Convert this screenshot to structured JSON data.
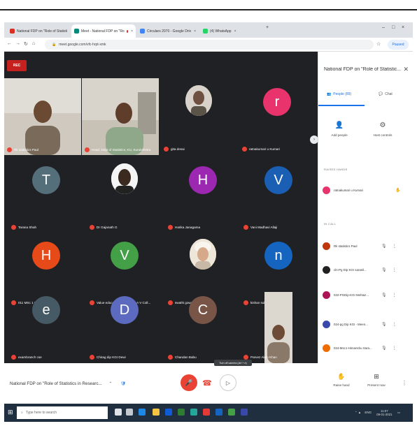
{
  "browser": {
    "tabs": [
      {
        "label": "National FDP on \"Role of Statisti",
        "favicon_color": "#d93025",
        "active": false
      },
      {
        "label": "Meet - National FDP on \"Ro",
        "favicon_color": "#00897b",
        "active": true
      },
      {
        "label": "Circulars 2070 - Google Driv",
        "favicon_color": "#4285f4",
        "active": false
      },
      {
        "label": "(4) WhatsApp",
        "favicon_color": "#25d366",
        "active": false
      }
    ],
    "new_tab": "+",
    "url": "meet.google.com/vfc-hrpt-xmk",
    "profile_label": "Paused"
  },
  "meet": {
    "rec_label": "REC",
    "tiles": [
      {
        "name": "Rk statistics Paul",
        "type": "video"
      },
      {
        "name": "Head, Dept of Statistics, KU, Kurukshetra",
        "type": "video"
      },
      {
        "name": "gita desai",
        "type": "photo"
      },
      {
        "name": "ratnakumari u Kumari",
        "type": "letter",
        "letter": "r",
        "color": "#e8336d"
      },
      {
        "name": "Tarana Shah",
        "type": "letter",
        "letter": "T",
        "color": "#546e7a"
      },
      {
        "name": "Dr Gajanath G",
        "type": "photo"
      },
      {
        "name": "Harika Janagama",
        "type": "letter",
        "letter": "H",
        "color": "#9c27b0"
      },
      {
        "name": "Vani Madhavi Allaji",
        "type": "letter",
        "letter": "V",
        "color": "#1a5fb4"
      },
      {
        "name": "011 MSc 1 Himanshu",
        "type": "letter",
        "letter": "H",
        "color": "#e64a19"
      },
      {
        "name": "Value education Committee A V Coll...",
        "type": "letter",
        "letter": "V",
        "color": "#43a047"
      },
      {
        "name": "swathi gowakonda",
        "type": "photo"
      },
      {
        "name": "kishan sultana",
        "type": "letter",
        "letter": "n",
        "color": "#1565c0"
      },
      {
        "name": "exambranch cse",
        "type": "letter",
        "letter": "e",
        "color": "#455a64"
      },
      {
        "name": "Chirag dip KGI Dewi",
        "type": "letter",
        "letter": "D",
        "color": "#5c6bc0"
      },
      {
        "name": "Chandan Babu",
        "type": "letter",
        "letter": "C",
        "color": "#795548"
      },
      {
        "name": "Parvez Alam Khan",
        "type": "video"
      }
    ]
  },
  "panel": {
    "title": "National FDP on \"Role of Statistic...",
    "tab_people": "People (89)",
    "tab_chat": "Chat",
    "add_people": "Add people",
    "host_controls": "Host controls",
    "section_raised": "RAISED HANDS",
    "raised": [
      {
        "name": "ratnakumari u Kumari",
        "color": "#e8336d"
      }
    ],
    "section_in_call": "IN CALL",
    "in_call": [
      {
        "name": "Rk statistics Paul",
        "color": "#bf360c"
      },
      {
        "name": "cln-Pg Dip KGI saranil...",
        "color": "#212121"
      },
      {
        "name": "022-PGDip-KGI Mehtaz...",
        "color": "#ad1457"
      },
      {
        "name": "024-pg Dip KGI - Meen...",
        "color": "#3949ab"
      },
      {
        "name": "024-Msc1-Himanshu Sara...",
        "color": "#ef6c00"
      }
    ]
  },
  "bottom": {
    "meeting_title": "National FDP on \"Role of Statistics in Researc...",
    "tooltip": "Turn off camera (ctrl + e)",
    "raise_hand": "Raise hand",
    "present_now": "Present now"
  },
  "taskbar": {
    "search_placeholder": "Type here to search",
    "time": "11:07",
    "date": "09-01-2021",
    "lang": "ENG"
  }
}
